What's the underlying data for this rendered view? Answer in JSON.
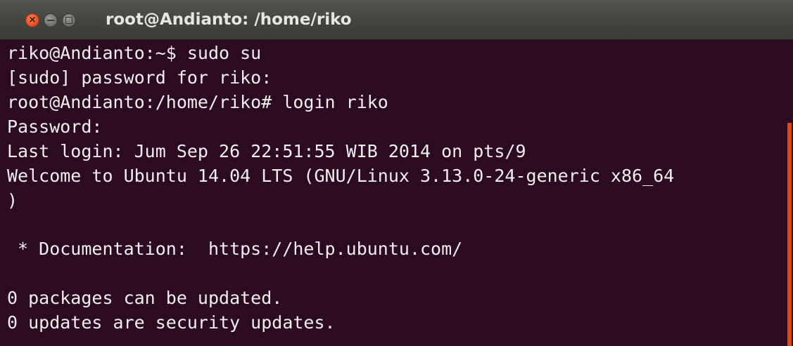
{
  "window": {
    "title": "root@Andianto: /home/riko",
    "colors": {
      "terminal_background": "#2c0a1f",
      "terminal_text": "#efefef",
      "titlebar": "#44443f",
      "close_button": "#e9552a",
      "scrollbar_thumb": "#dd4814"
    }
  },
  "terminal": {
    "lines": [
      "riko@Andianto:~$ sudo su",
      "[sudo] password for riko:",
      "root@Andianto:/home/riko# login riko",
      "Password:",
      "Last login: Jum Sep 26 22:51:55 WIB 2014 on pts/9",
      "Welcome to Ubuntu 14.04 LTS (GNU/Linux 3.13.0-24-generic x86_64",
      ")",
      "",
      " * Documentation:  https://help.ubuntu.com/",
      "",
      "0 packages can be updated.",
      "0 updates are security updates."
    ]
  }
}
